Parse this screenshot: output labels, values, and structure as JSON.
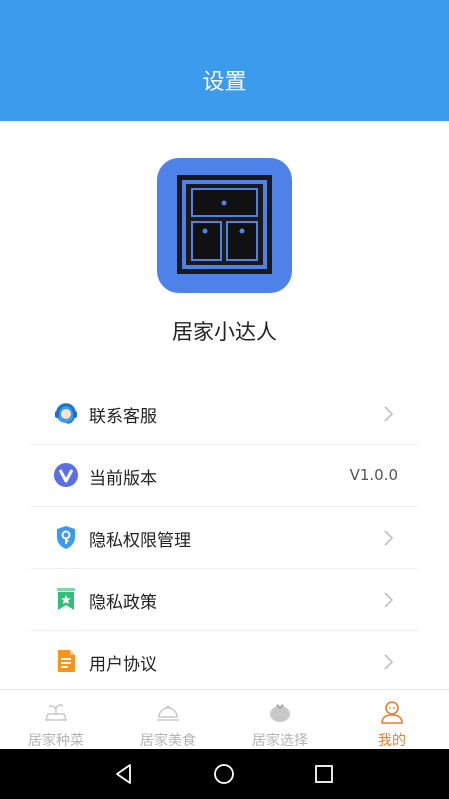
{
  "header": {
    "title": "设置"
  },
  "app": {
    "name": "居家小达人"
  },
  "menu": [
    {
      "label": "联系客服",
      "icon": "headset-icon"
    },
    {
      "label": "当前版本",
      "icon": "version-v-icon",
      "value": "V1.0.0"
    },
    {
      "label": "隐私权限管理",
      "icon": "shield-key-icon"
    },
    {
      "label": "隐私政策",
      "icon": "bookmark-star-icon"
    },
    {
      "label": "用户协议",
      "icon": "document-icon"
    }
  ],
  "tabs": [
    {
      "label": "居家种菜",
      "icon": "planting-icon"
    },
    {
      "label": "居家美食",
      "icon": "food-dome-icon"
    },
    {
      "label": "居家选择",
      "icon": "tomato-icon"
    },
    {
      "label": "我的",
      "icon": "profile-icon",
      "active": true
    }
  ],
  "colors": {
    "header": "#3d9bee",
    "accent": "#f07c2a",
    "logo_bg": "#4e82e8"
  }
}
